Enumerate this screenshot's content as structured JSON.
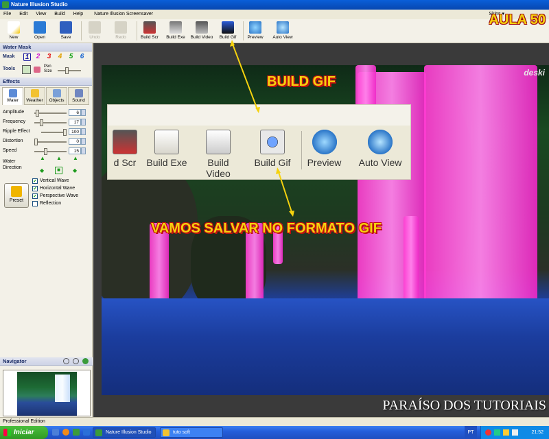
{
  "window": {
    "title": "Nature Illusion Studio"
  },
  "menu": [
    "File",
    "Edit",
    "View",
    "Build",
    "Help",
    "Nature Illusion Screensaver"
  ],
  "skins_label": "Skins ▾",
  "toolbar": [
    {
      "label": "New",
      "icon": "new-icon"
    },
    {
      "label": "Open",
      "icon": "open-folder-icon"
    },
    {
      "label": "Save",
      "icon": "save-disk-icon"
    },
    {
      "label": "Undo",
      "icon": "undo-icon",
      "disabled": true
    },
    {
      "label": "Redo",
      "icon": "redo-icon",
      "disabled": true
    },
    {
      "label": "Build Scr",
      "icon": "build-scr-icon"
    },
    {
      "label": "Build Exe",
      "icon": "build-exe-icon"
    },
    {
      "label": "Build Video",
      "icon": "build-video-icon"
    },
    {
      "label": "Build Gif",
      "icon": "build-gif-icon"
    },
    {
      "label": "Preview",
      "icon": "preview-icon"
    },
    {
      "label": "Auto View",
      "icon": "auto-view-icon"
    }
  ],
  "overlay_title": "AULA 50",
  "water_mask": {
    "header": "Water Mask",
    "mask_label": "Mask",
    "mask_numbers": [
      "1",
      "2",
      "3",
      "4",
      "5",
      "6"
    ],
    "mask_colors": [
      "#1a1aa0",
      "#d01ad0",
      "#e01010",
      "#e0a000",
      "#10a010",
      "#1060d0"
    ],
    "tools_label": "Tools",
    "pen_size_label": "Pen Size"
  },
  "effects": {
    "header": "Effects",
    "tabs": [
      "Water",
      "Weather",
      "Objects",
      "Sound"
    ],
    "active_tab": "Water",
    "params": [
      {
        "label": "Amplitude",
        "value": "6"
      },
      {
        "label": "Frequency",
        "value": "17"
      },
      {
        "label": "Ripple Effect",
        "value": "100"
      },
      {
        "label": "Distortion",
        "value": "0"
      },
      {
        "label": "Speed",
        "value": "15"
      }
    ],
    "water_direction_label": "Water Direction",
    "preset_label": "Preset",
    "checkboxes": [
      {
        "label": "Vertical Wave",
        "checked": true
      },
      {
        "label": "Horizontal Wave",
        "checked": true
      },
      {
        "label": "Perspective Wave",
        "checked": true
      },
      {
        "label": "Reflection",
        "checked": false
      }
    ]
  },
  "navigator": {
    "header": "Navigator"
  },
  "status_bar": "Professional Edition",
  "canvas": {
    "logo_text": "deski",
    "zoom_buttons": [
      "d Scr",
      "Build Exe",
      "Build Video",
      "Build Gif",
      "Preview",
      "Auto View"
    ],
    "annotation_top": "BUILD GIF",
    "annotation_bottom": "VAMOS SALVAR NO FORMATO GIF",
    "watermark": "PARAÍSO DOS TUTORIAIS"
  },
  "taskbar": {
    "start_label": "Iniciar",
    "tasks": [
      "Nature Illusion Studio",
      "tuto soft"
    ],
    "clock": "21:52",
    "lang": "PT"
  }
}
